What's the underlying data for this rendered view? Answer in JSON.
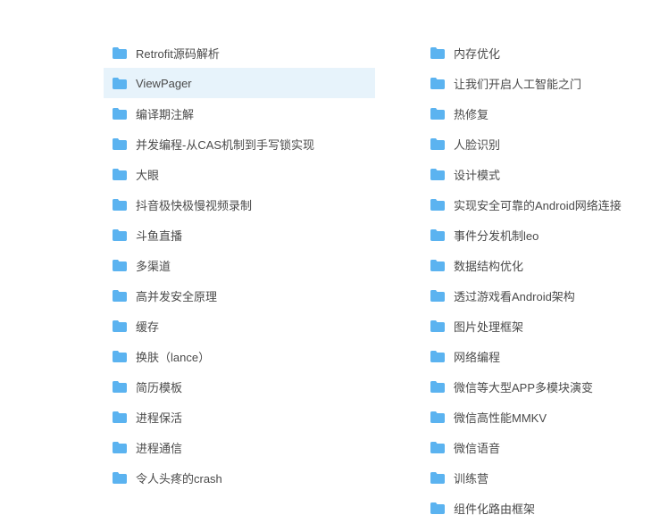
{
  "colors": {
    "folder": "#5bb3f0",
    "selected_bg": "#e7f3fb"
  },
  "left_column": [
    {
      "label": "Retrofit源码解析",
      "selected": false
    },
    {
      "label": "ViewPager",
      "selected": true
    },
    {
      "label": "编译期注解",
      "selected": false
    },
    {
      "label": "并发编程-从CAS机制到手写锁实现",
      "selected": false
    },
    {
      "label": "大眼",
      "selected": false
    },
    {
      "label": "抖音极快极慢视频录制",
      "selected": false
    },
    {
      "label": "斗鱼直播",
      "selected": false
    },
    {
      "label": "多渠道",
      "selected": false
    },
    {
      "label": "高并发安全原理",
      "selected": false
    },
    {
      "label": "缓存",
      "selected": false
    },
    {
      "label": "换肤（lance）",
      "selected": false
    },
    {
      "label": "简历模板",
      "selected": false
    },
    {
      "label": "进程保活",
      "selected": false
    },
    {
      "label": "进程通信",
      "selected": false
    },
    {
      "label": "令人头疼的crash",
      "selected": false
    }
  ],
  "right_column": [
    {
      "label": "内存优化"
    },
    {
      "label": "让我们开启人工智能之门"
    },
    {
      "label": "热修复"
    },
    {
      "label": "人脸识别"
    },
    {
      "label": "设计模式"
    },
    {
      "label": "实现安全可靠的Android网络连接"
    },
    {
      "label": "事件分发机制leo"
    },
    {
      "label": "数据结构优化"
    },
    {
      "label": "透过游戏看Android架构"
    },
    {
      "label": "图片处理框架"
    },
    {
      "label": "网络编程"
    },
    {
      "label": "微信等大型APP多模块演变"
    },
    {
      "label": "微信高性能MMKV"
    },
    {
      "label": "微信语音"
    },
    {
      "label": "训练营"
    },
    {
      "label": "组件化路由框架"
    }
  ]
}
